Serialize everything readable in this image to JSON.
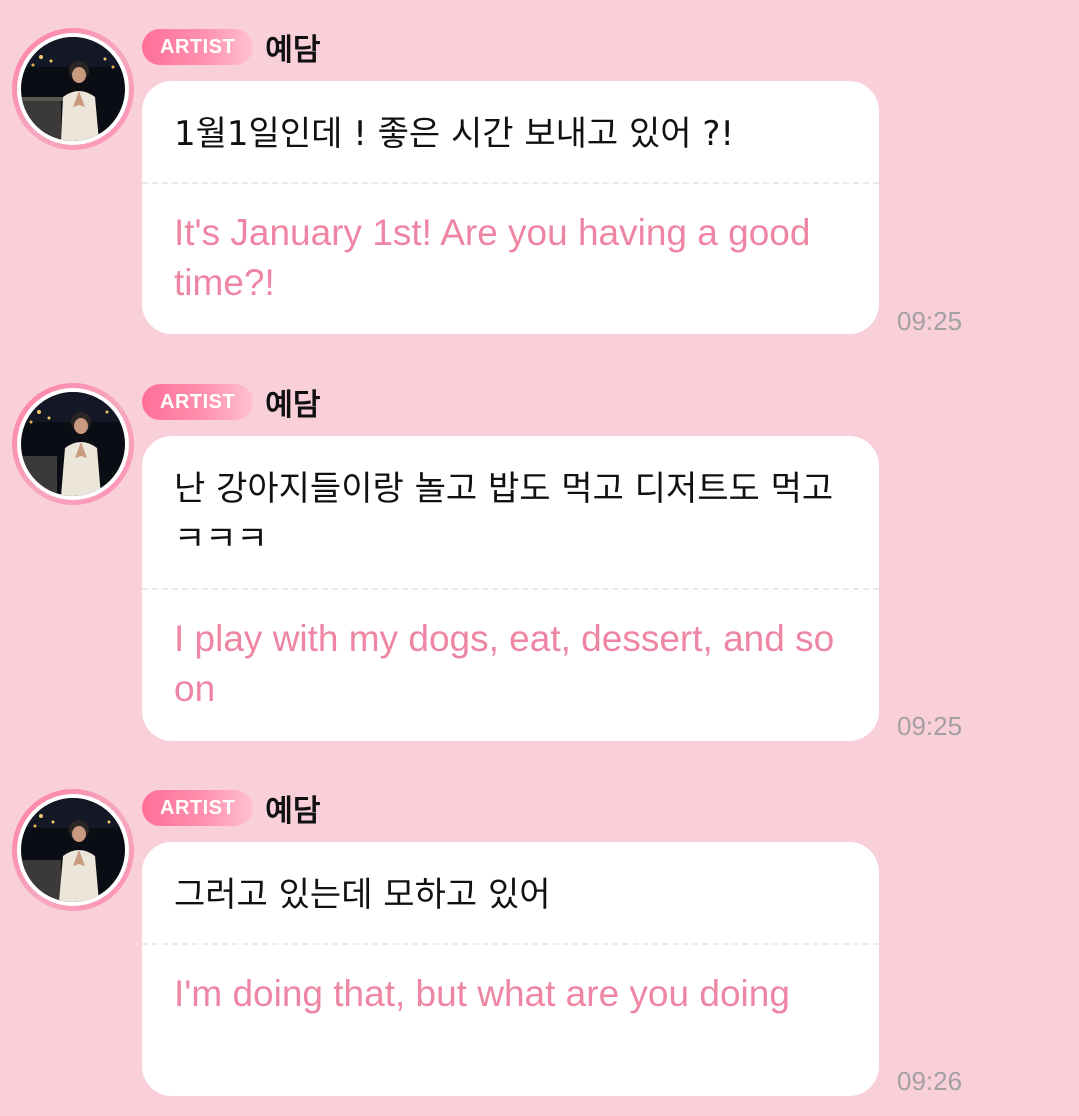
{
  "messages": [
    {
      "badge": "ARTIST",
      "sender": "예담",
      "original": "1월1일인데 ! 좋은 시간 보내고 있어 ?!",
      "translation": "It's January 1st! Are you having a good time?!",
      "time": "09:25"
    },
    {
      "badge": "ARTIST",
      "sender": "예담",
      "original": "난 강아지들이랑 놀고 밥도 먹고 디저트도 먹고 ㅋㅋㅋ",
      "translation": "I play with my dogs, eat, dessert, and so on",
      "time": "09:25"
    },
    {
      "badge": "ARTIST",
      "sender": "예담",
      "original": "그러고 있는데 모하고 있어",
      "translation": "I'm doing that, but what are you doing",
      "time": "09:26"
    }
  ],
  "colors": {
    "background": "#f9d0da",
    "bubble": "#ffffff",
    "translation_text": "#ee86a3",
    "badge_gradient_start": "#ff6f98",
    "timestamp": "#a4a0a2"
  },
  "icons": {
    "avatar": "artist-profile-photo"
  }
}
